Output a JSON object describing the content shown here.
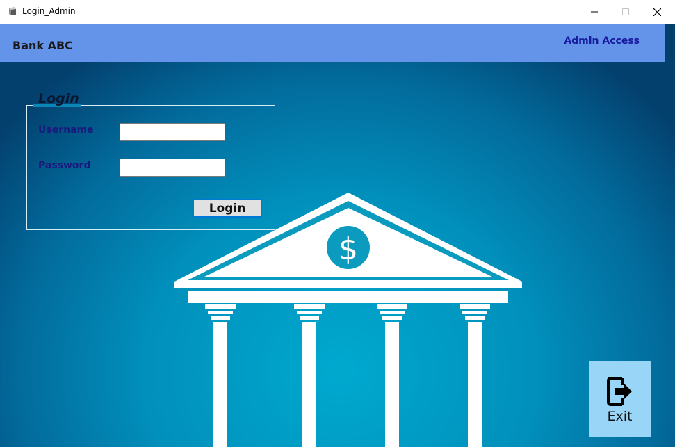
{
  "window": {
    "title": "Login_Admin",
    "controls": {
      "minimize_icon": "minimize-icon",
      "maximize_icon": "maximize-icon",
      "close_icon": "close-icon"
    }
  },
  "header": {
    "bank_name": "Bank ABC",
    "admin_access": "Admin Access",
    "color": "#6394ea"
  },
  "login": {
    "legend": "Login",
    "username_label": "Username",
    "username_value": "",
    "password_label": "Password",
    "password_value": "",
    "button_label": "Login"
  },
  "illustration": {
    "icon": "bank-building-icon",
    "symbol": "$"
  },
  "exit": {
    "label": "Exit",
    "icon": "exit-door-icon",
    "color": "#99d5f7"
  },
  "colors": {
    "background_center": "#00a9cf",
    "background_edge": "#03406e",
    "label": "#1a1a7e",
    "admin": "#1a1a9e"
  }
}
